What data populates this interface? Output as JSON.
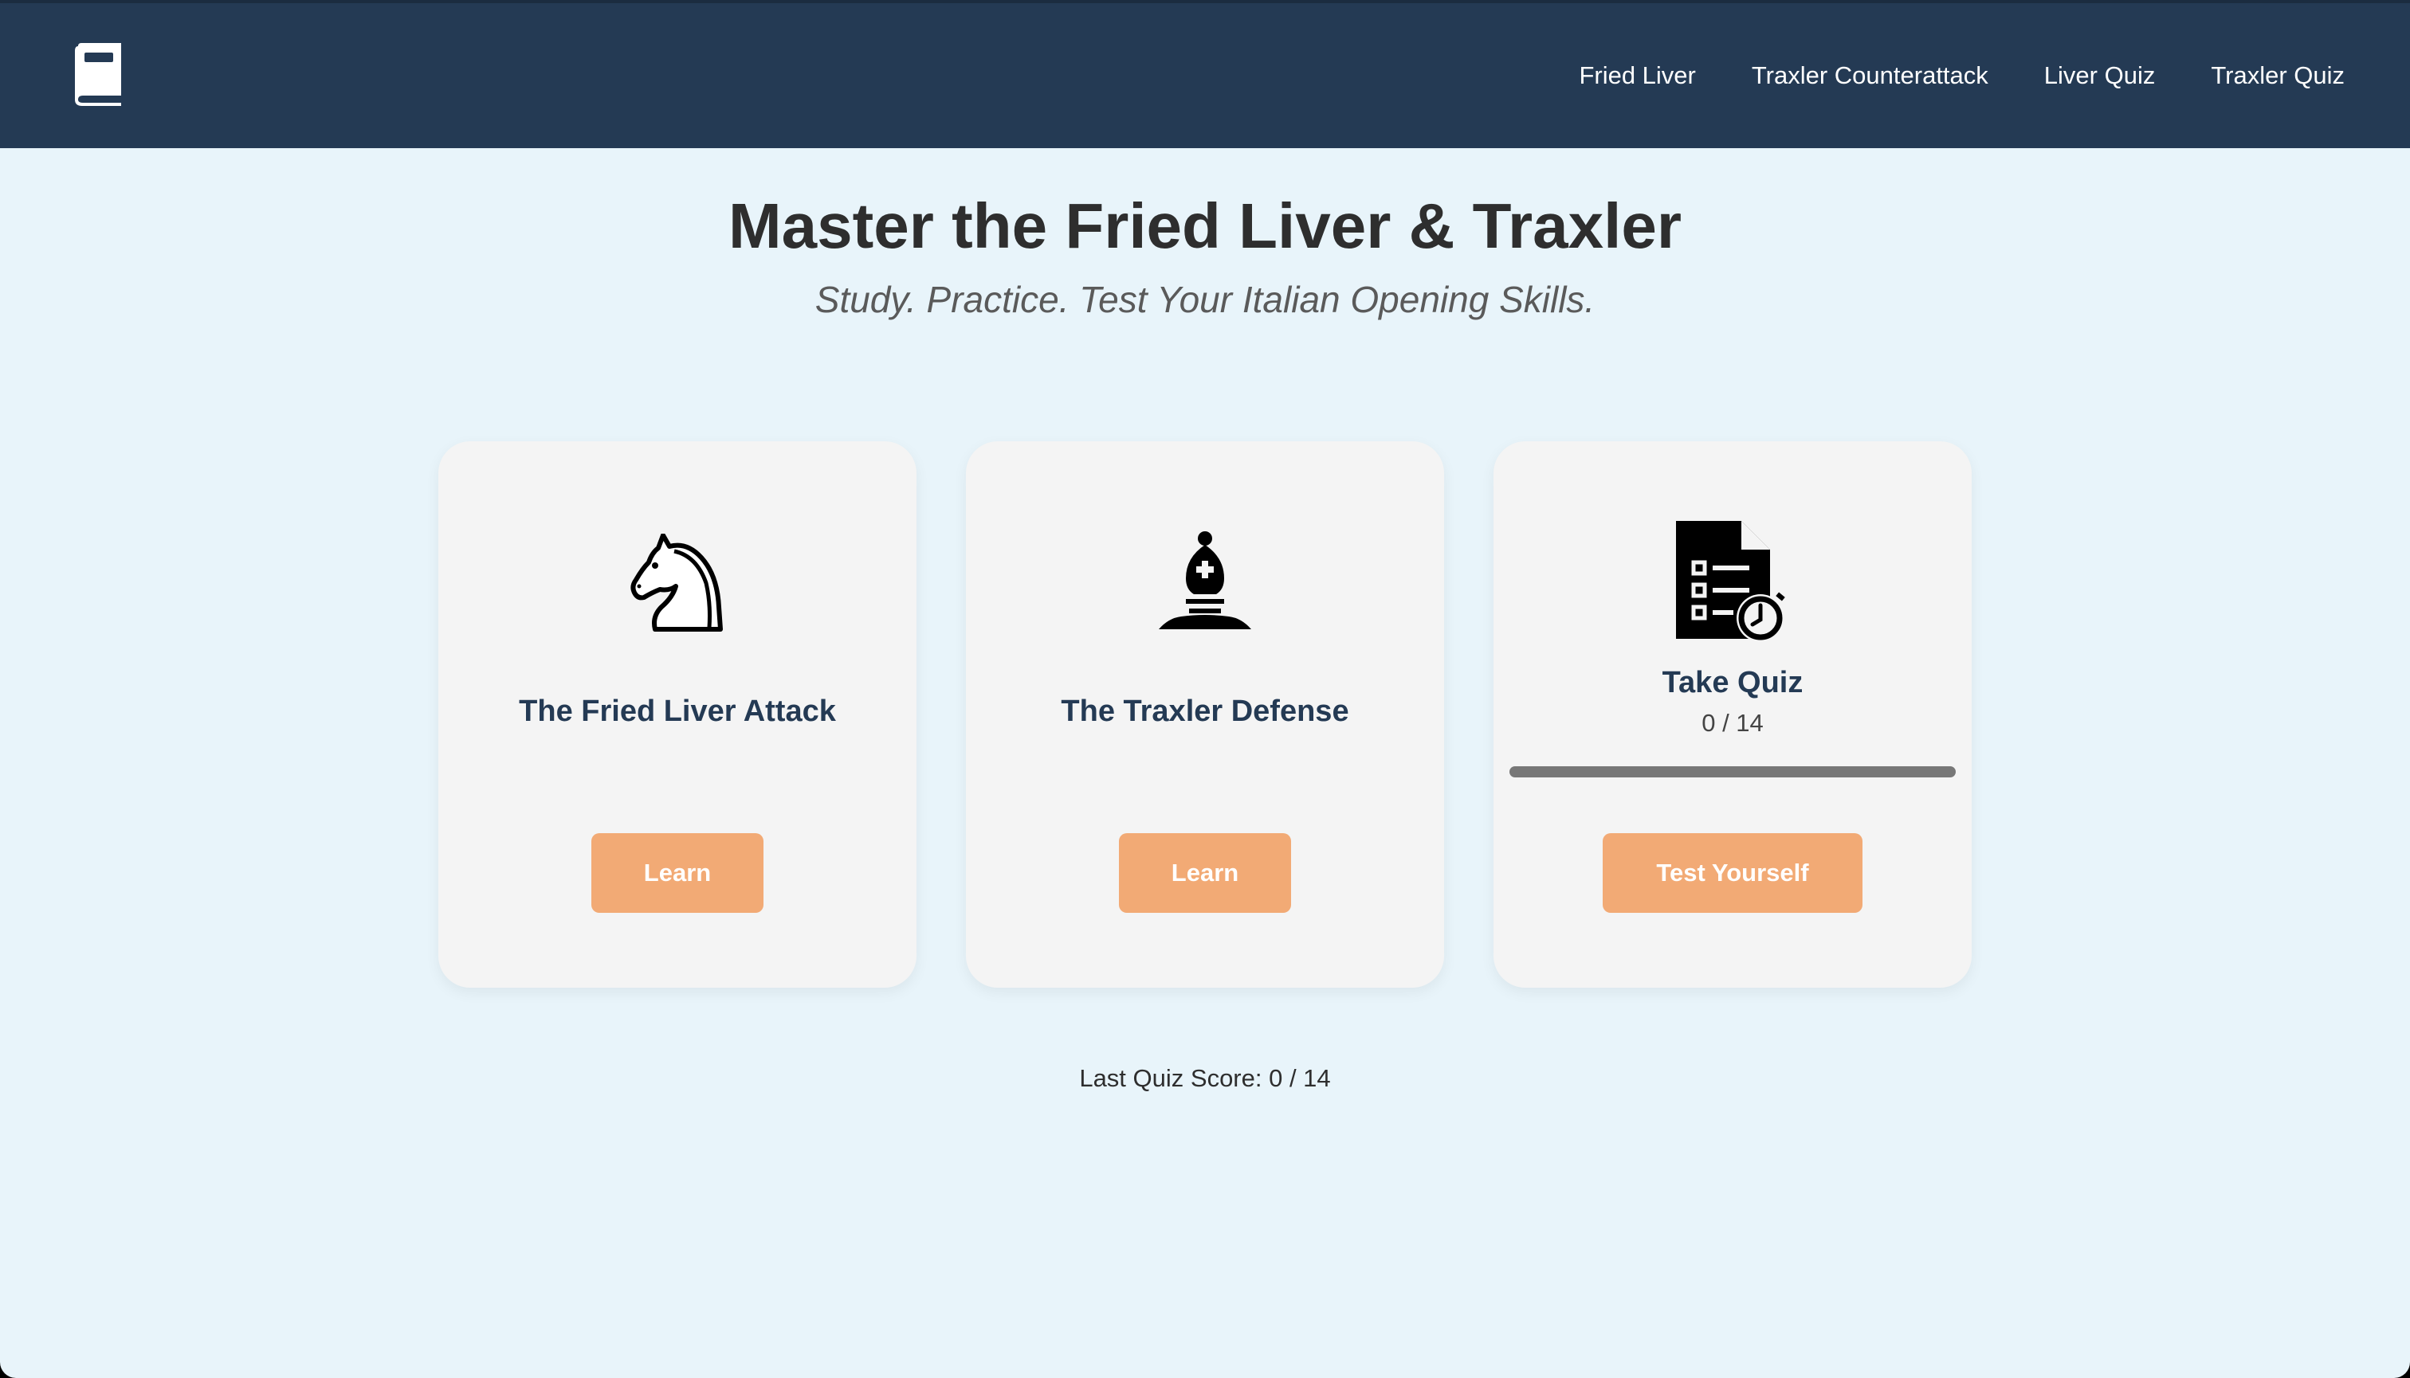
{
  "nav": {
    "brand_icon": "book-icon",
    "links": [
      "Fried Liver",
      "Traxler Counterattack",
      "Liver Quiz",
      "Traxler Quiz"
    ]
  },
  "hero": {
    "title": "Master the Fried Liver & Traxler",
    "subtitle": "Study. Practice. Test Your Italian Opening Skills."
  },
  "cards": [
    {
      "icon": "chess-knight-icon",
      "title": "The Fried Liver Attack",
      "button": "Learn"
    },
    {
      "icon": "chess-bishop-icon",
      "title": "The Traxler Defense",
      "button": "Learn"
    },
    {
      "icon": "quiz-timer-icon",
      "title": "Take Quiz",
      "progress_text": "0 / 14",
      "progress_fraction": 0,
      "button": "Test Yourself"
    }
  ],
  "footer": {
    "last_score": "Last Quiz Score: 0 / 14"
  },
  "colors": {
    "navbar": "#243a54",
    "background": "#e8f4fa",
    "card": "#f4f4f4",
    "button": "#f2aa75",
    "title_text": "#243a54",
    "progress_track": "#777777"
  }
}
